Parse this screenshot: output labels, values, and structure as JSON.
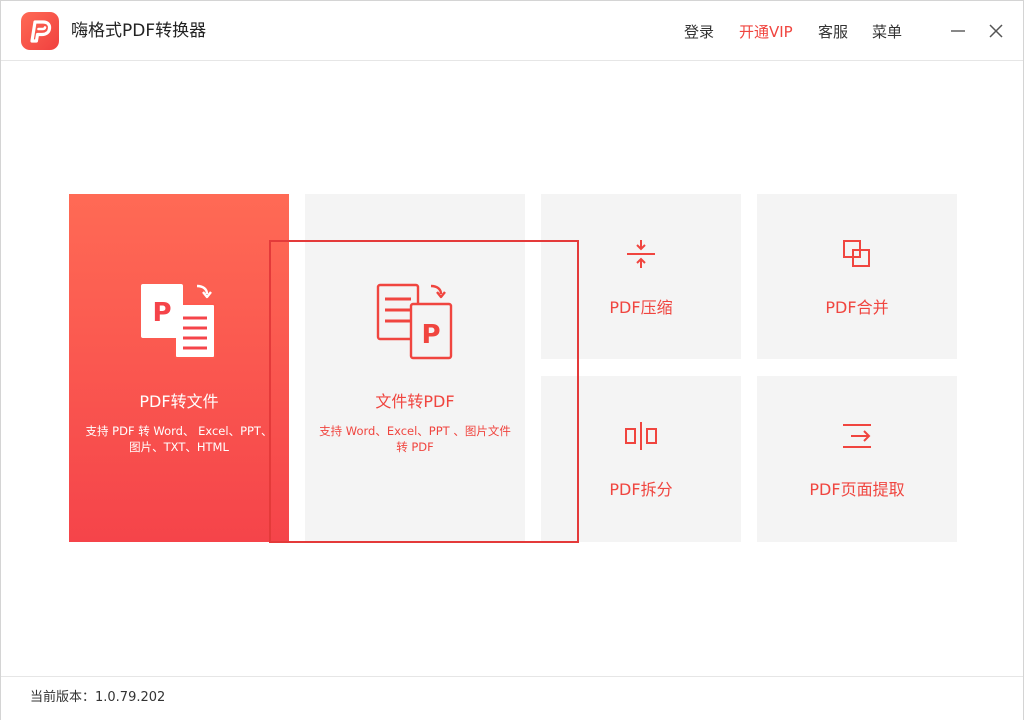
{
  "app": {
    "title": "嗨格式PDF转换器",
    "logo_letter": "P",
    "accent_color": "#f0453f"
  },
  "topnav": {
    "login": "登录",
    "vip": "开通VIP",
    "service": "客服",
    "menu": "菜单"
  },
  "window_controls": {
    "minimize": "minimize-icon",
    "close": "close-icon"
  },
  "cards": {
    "pdf_to_file": {
      "title": "PDF转文件",
      "desc": "支持 PDF 转 Word、 Excel、PPT、图片、TXT、HTML",
      "icon": "pdf-to-file-icon",
      "icon_letter": "P"
    },
    "file_to_pdf": {
      "title": "文件转PDF",
      "desc": "支持 Word、Excel、PPT 、图片文件转 PDF",
      "icon": "file-to-pdf-icon",
      "icon_letter": "P"
    },
    "compress": {
      "title": "PDF压缩",
      "icon": "compress-icon"
    },
    "merge": {
      "title": "PDF合并",
      "icon": "merge-icon"
    },
    "split": {
      "title": "PDF拆分",
      "icon": "split-icon"
    },
    "extract": {
      "title": "PDF页面提取",
      "icon": "extract-icon"
    }
  },
  "footer": {
    "version": "当前版本：1.0.79.202"
  }
}
